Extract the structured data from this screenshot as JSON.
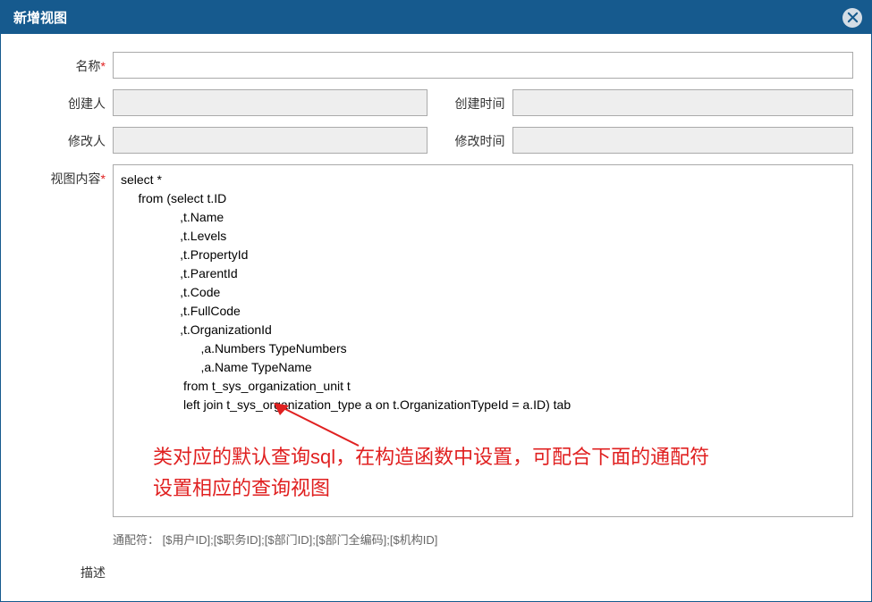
{
  "header": {
    "title": "新增视图"
  },
  "form": {
    "name_label": "名称",
    "name_value": "",
    "creator_label": "创建人",
    "creator_value": "",
    "create_time_label": "创建时间",
    "create_time_value": "",
    "modifier_label": "修改人",
    "modifier_value": "",
    "modify_time_label": "修改时间",
    "modify_time_value": "",
    "content_label": "视图内容",
    "content_value": "select *\n     from (select t.ID\n                 ,t.Name\n                 ,t.Levels\n                 ,t.PropertyId\n                 ,t.ParentId\n                 ,t.Code\n                 ,t.FullCode\n                 ,t.OrganizationId\n                       ,a.Numbers TypeNumbers\n                       ,a.Name TypeName\n                  from t_sys_organization_unit t\n                  left join t_sys_organization_type a on t.OrganizationTypeId = a.ID) tab",
    "wildcard_label": "通配符：",
    "wildcard_text": "[$用户ID];[$职务ID];[$部门ID];[$部门全编码];[$机构ID]",
    "desc_label": "描述"
  },
  "annotation": {
    "line1": "类对应的默认查询sql，在构造函数中设置，可配合下面的通配符",
    "line2": "设置相应的查询视图"
  }
}
